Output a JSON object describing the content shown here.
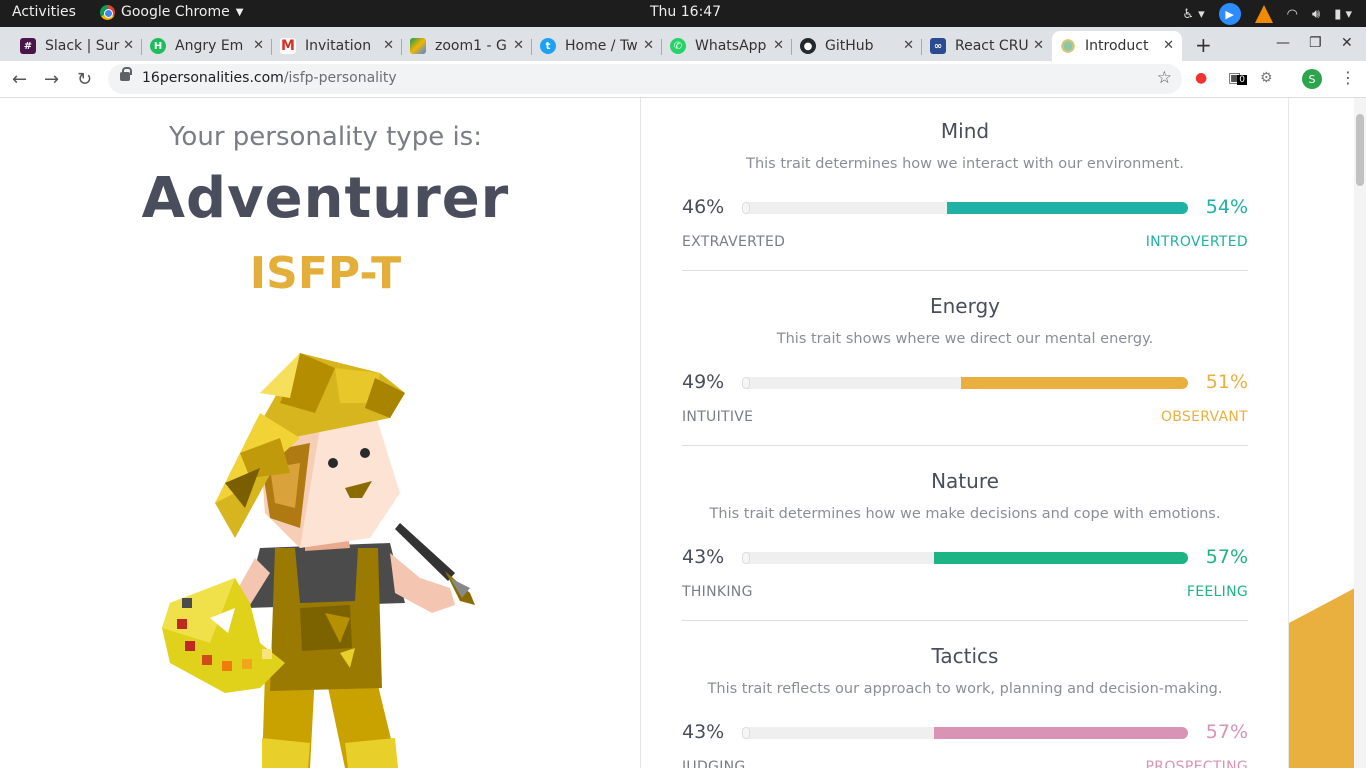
{
  "topbar": {
    "activities": "Activities",
    "app_name": "Google Chrome",
    "clock": "Thu 16:47"
  },
  "tabs": [
    {
      "title": "Slack | Sur",
      "fav_color": "#4a154b"
    },
    {
      "title": "Angry Em",
      "fav_color": "#1ebd5c"
    },
    {
      "title": "Invitation",
      "fav_color": "#d93025"
    },
    {
      "title": "zoom1 - G",
      "fav_color": "#f4b400"
    },
    {
      "title": "Home / Tw",
      "fav_color": "#1da1f2"
    },
    {
      "title": "WhatsApp",
      "fav_color": "#25d366"
    },
    {
      "title": "GitHub",
      "fav_color": "#24292e"
    },
    {
      "title": "React CRU",
      "fav_color": "#2c4a8f"
    },
    {
      "title": "Introduct",
      "fav_color": "#88c7a8"
    }
  ],
  "omnibox": {
    "domain": "16personalities.com",
    "path": "/isfp-personality"
  },
  "profile_initial": "S",
  "extension_badge": "0",
  "result": {
    "intro": "Your personality type is:",
    "type_name": "Adventurer",
    "type_code": "ISFP-T"
  },
  "traits": [
    {
      "name": "Mind",
      "description": "This trait determines how we interact with our environment.",
      "left_pct": "46%",
      "right_pct": "54%",
      "left_label": "EXTRAVERTED",
      "right_label": "INTROVERTED",
      "right_value": 54,
      "color": "#1fb1a4"
    },
    {
      "name": "Energy",
      "description": "This trait shows where we direct our mental energy.",
      "left_pct": "49%",
      "right_pct": "51%",
      "left_label": "INTUITIVE",
      "right_label": "OBSERVANT",
      "right_value": 51,
      "color": "#e9b03f"
    },
    {
      "name": "Nature",
      "description": "This trait determines how we make decisions and cope with emotions.",
      "left_pct": "43%",
      "right_pct": "57%",
      "left_label": "THINKING",
      "right_label": "FEELING",
      "right_value": 57,
      "color": "#1db483"
    },
    {
      "name": "Tactics",
      "description": "This trait reflects our approach to work, planning and decision-making.",
      "left_pct": "43%",
      "right_pct": "57%",
      "left_label": "JUDGING",
      "right_label": "PROSPECTING",
      "right_value": 57,
      "color": "#d993b5"
    }
  ]
}
